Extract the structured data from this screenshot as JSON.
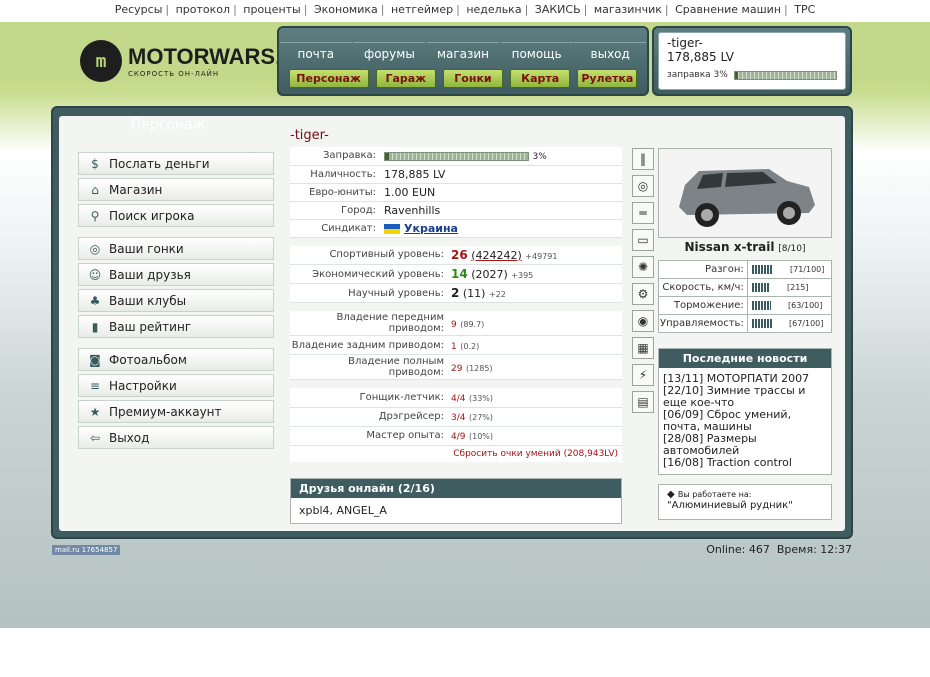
{
  "topnav": [
    "Ресурсы",
    "протокол",
    "проценты",
    "Экономика",
    "нетгеймер",
    "неделька",
    "ЗАКИСЬ",
    "магазинчик",
    "Сравнение машин",
    "ТРС"
  ],
  "logo": {
    "mark": "m",
    "title": "MOTORWARS.RU",
    "subtitle": "СКОРОСТЬ ОН-ЛАЙН"
  },
  "menu": {
    "top": [
      "почта",
      "форумы",
      "магазин",
      "помощь",
      "выход"
    ],
    "bottom": [
      "Персонаж",
      "Гараж",
      "Гонки",
      "Карта",
      "Рулетка"
    ]
  },
  "user": {
    "name": "-tiger-",
    "money": "178,885 LV",
    "fuel_label": "заправка 3%",
    "fuel_fraction": 0.03
  },
  "sidebar": {
    "header": "Персонаж",
    "groups": [
      [
        {
          "label": "Послать деньги",
          "icon": "money-icon"
        },
        {
          "label": "Магазин",
          "icon": "shop-icon"
        },
        {
          "label": "Поиск игрока",
          "icon": "search-icon"
        }
      ],
      [
        {
          "label": "Ваши гонки",
          "icon": "steering-icon"
        },
        {
          "label": "Ваши друзья",
          "icon": "friends-icon"
        },
        {
          "label": "Ваши клубы",
          "icon": "clubs-icon"
        },
        {
          "label": "Ваш рейтинг",
          "icon": "rating-icon"
        }
      ],
      [
        {
          "label": "Фотоальбом",
          "icon": "camera-icon"
        },
        {
          "label": "Настройки",
          "icon": "settings-icon"
        },
        {
          "label": "Премиум-аккаунт",
          "icon": "premium-icon"
        },
        {
          "label": "Выход",
          "icon": "exit-icon"
        }
      ]
    ]
  },
  "profile": {
    "name": "-tiger-",
    "fuel_label": "Заправка:",
    "fuel_value": "3%",
    "fuel_fraction": 0.03,
    "cash_label": "Наличность:",
    "cash_value": "178,885 LV",
    "euro_label": "Евро-юниты:",
    "euro_value": "1.00 EUN",
    "city_label": "Город:",
    "city_value": "Ravenhills",
    "syndicate_label": "Синдикат:",
    "syndicate_value": "Украина"
  },
  "levels": [
    {
      "label": "Спортивный уровень:",
      "level": "26",
      "points": "(424242)",
      "plus": "+49791",
      "color": "red"
    },
    {
      "label": "Экономический уровень:",
      "level": "14",
      "points": "(2027)",
      "plus": "+395",
      "color": "green"
    },
    {
      "label": "Научный уровень:",
      "level": "2",
      "points": "(11)",
      "plus": "+22",
      "color": "dark"
    }
  ],
  "ownership": [
    {
      "label": "Владение передним приводом:",
      "level": "9",
      "points": "(89.7)"
    },
    {
      "label": "Владение задним приводом:",
      "level": "1",
      "points": "(0.2)"
    },
    {
      "label": "Владение полным приводом:",
      "level": "29",
      "points": "(1285)"
    }
  ],
  "skills": [
    {
      "label": "Гонщик-летчик:",
      "value": "4/4",
      "percent": "(33%)"
    },
    {
      "label": "Дрэгрейсер:",
      "value": "3/4",
      "percent": "(27%)"
    },
    {
      "label": "Мастер опыта:",
      "value": "4/9",
      "percent": "(10%)"
    }
  ],
  "reset_link": "Сбросить очки умений (208,943LV)",
  "car": {
    "name": "Nissan x-trail",
    "rating": "[8/10]",
    "stats": [
      {
        "label": "Разгон:",
        "value": "[71/100]",
        "fraction": 0.71
      },
      {
        "label": "Скорость, км/ч:",
        "value": "[215]",
        "fraction": 0.6
      },
      {
        "label": "Торможение:",
        "value": "[63/100]",
        "fraction": 0.63
      },
      {
        "label": "Управляемость:",
        "value": "[67/100]",
        "fraction": 0.67
      }
    ]
  },
  "news": {
    "header": "Последние новости",
    "items": [
      "[13/11] МОТОРПАТИ 2007",
      "[22/10] Зимние трассы и еще кое-что",
      "[06/09] Сброс умений, почта, машины",
      "[28/08] Размеры автомобилей",
      "[16/08] Traction control"
    ]
  },
  "friends": {
    "header": "Друзья онлайн (2/16)",
    "list": "xpbl4, ANGEL_A"
  },
  "work": {
    "label": "Вы работаете на:",
    "value": "\"Алюминиевый рудник\""
  },
  "footer": {
    "counter": "mail.ru 17654857",
    "online": "Online: 467",
    "time": "Время: 12:37"
  },
  "colors": {
    "panel": "#3f5c60",
    "accent_green": "#b6d178",
    "button_text": "#7a1010"
  }
}
